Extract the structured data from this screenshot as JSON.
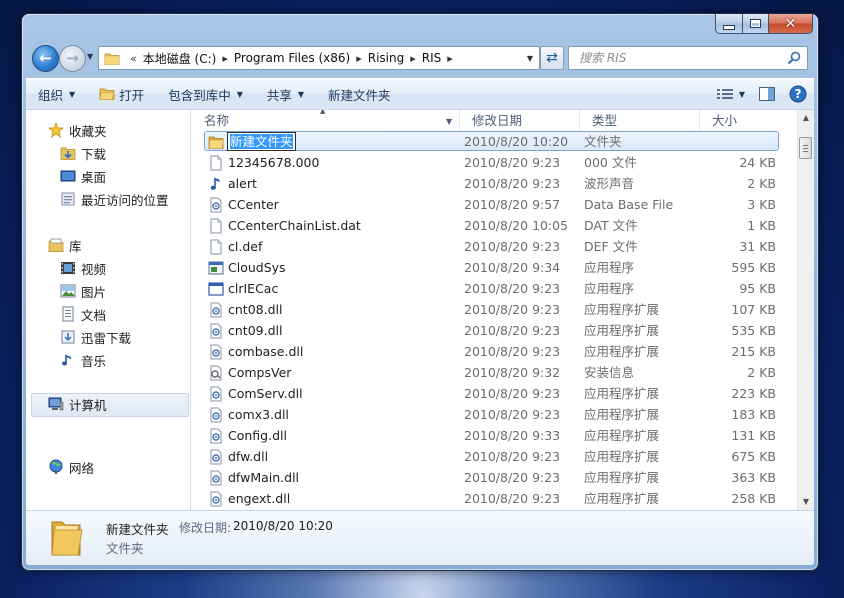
{
  "window": {
    "caption": {
      "minimize": "minimize",
      "maximize": "maximize",
      "close": "close"
    }
  },
  "navbar": {
    "breadcrumb_prefix": "«",
    "crumbs": [
      "本地磁盘 (C:)",
      "Program Files (x86)",
      "Rising",
      "RIS"
    ],
    "search_placeholder": "搜索 RIS"
  },
  "toolbar": {
    "organize": "组织",
    "open": "打开",
    "include_in_library": "包含到库中",
    "share": "共享",
    "new_folder": "新建文件夹"
  },
  "nav": {
    "favorites": "收藏夹",
    "downloads": "下载",
    "desktop": "桌面",
    "recent": "最近访问的位置",
    "libraries": "库",
    "videos": "视频",
    "pictures": "图片",
    "documents": "文档",
    "xunlei": "迅雷下载",
    "music": "音乐",
    "computer": "计算机",
    "network": "网络"
  },
  "columns": {
    "name": "名称",
    "date": "修改日期",
    "type": "类型",
    "size": "大小"
  },
  "files": [
    {
      "name": "新建文件夹",
      "date": "2010/8/20 10:20",
      "type": "文件夹",
      "size": "",
      "icon": "folder"
    },
    {
      "name": "12345678.000",
      "date": "2010/8/20 9:23",
      "type": "000 文件",
      "size": "24 KB",
      "icon": "blank"
    },
    {
      "name": "alert",
      "date": "2010/8/20 9:23",
      "type": "波形声音",
      "size": "2 KB",
      "icon": "audio"
    },
    {
      "name": "CCenter",
      "date": "2010/8/20 9:57",
      "type": "Data Base File",
      "size": "3 KB",
      "icon": "gear-doc"
    },
    {
      "name": "CCenterChainList.dat",
      "date": "2010/8/20 10:05",
      "type": "DAT 文件",
      "size": "1 KB",
      "icon": "blank"
    },
    {
      "name": "cl.def",
      "date": "2010/8/20 9:23",
      "type": "DEF 文件",
      "size": "31 KB",
      "icon": "blank"
    },
    {
      "name": "CloudSys",
      "date": "2010/8/20 9:34",
      "type": "应用程序",
      "size": "595 KB",
      "icon": "exe"
    },
    {
      "name": "clrIECac",
      "date": "2010/8/20 9:23",
      "type": "应用程序",
      "size": "95 KB",
      "icon": "exe-window"
    },
    {
      "name": "cnt08.dll",
      "date": "2010/8/20 9:23",
      "type": "应用程序扩展",
      "size": "107 KB",
      "icon": "gear-doc"
    },
    {
      "name": "cnt09.dll",
      "date": "2010/8/20 9:23",
      "type": "应用程序扩展",
      "size": "535 KB",
      "icon": "gear-doc"
    },
    {
      "name": "combase.dll",
      "date": "2010/8/20 9:23",
      "type": "应用程序扩展",
      "size": "215 KB",
      "icon": "gear-doc"
    },
    {
      "name": "CompsVer",
      "date": "2010/8/20 9:32",
      "type": "安装信息",
      "size": "2 KB",
      "icon": "ini"
    },
    {
      "name": "ComServ.dll",
      "date": "2010/8/20 9:23",
      "type": "应用程序扩展",
      "size": "223 KB",
      "icon": "gear-doc"
    },
    {
      "name": "comx3.dll",
      "date": "2010/8/20 9:23",
      "type": "应用程序扩展",
      "size": "183 KB",
      "icon": "gear-doc"
    },
    {
      "name": "Config.dll",
      "date": "2010/8/20 9:33",
      "type": "应用程序扩展",
      "size": "131 KB",
      "icon": "gear-doc"
    },
    {
      "name": "dfw.dll",
      "date": "2010/8/20 9:23",
      "type": "应用程序扩展",
      "size": "675 KB",
      "icon": "gear-doc"
    },
    {
      "name": "dfwMain.dll",
      "date": "2010/8/20 9:23",
      "type": "应用程序扩展",
      "size": "363 KB",
      "icon": "gear-doc"
    },
    {
      "name": "engext.dll",
      "date": "2010/8/20 9:23",
      "type": "应用程序扩展",
      "size": "258 KB",
      "icon": "gear-doc"
    }
  ],
  "details": {
    "name": "新建文件夹",
    "modified_label": "修改日期:",
    "modified": "2010/8/20 10:20",
    "type": "文件夹"
  }
}
